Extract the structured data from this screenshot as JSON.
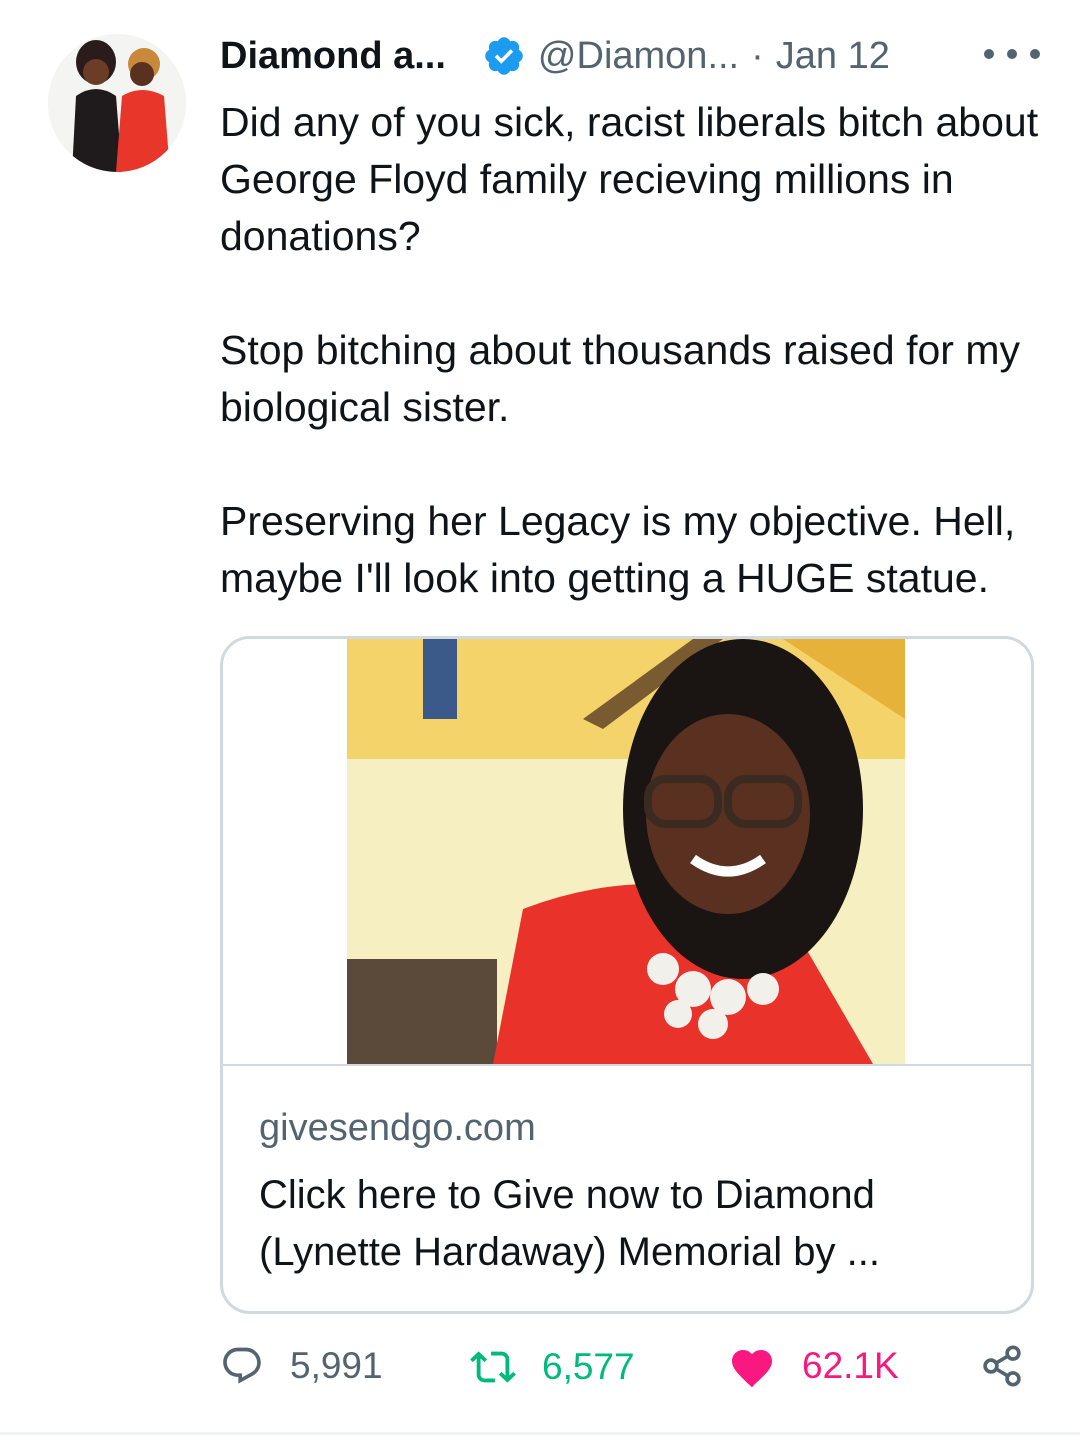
{
  "tweet": {
    "author_name": "Diamond a...",
    "handle": "@Diamon...",
    "separator": "·",
    "date": "Jan 12",
    "paragraphs": [
      "Did any of you sick, racist liberals bitch about George Floyd family recieving millions in donations?",
      "Stop bitching about thousands raised for my biological sister.",
      "Preserving her Legacy is my objective. Hell, maybe I'll look into getting a HUGE statue."
    ]
  },
  "card": {
    "domain": "givesendgo.com",
    "title": "Click here to Give now to Diamond (Lynette Hardaway) Memorial by ..."
  },
  "actions": {
    "replies": "5,991",
    "retweets": "6,577",
    "likes": "62.1K"
  },
  "icons": {
    "verified": "verified-badge-icon",
    "more": "more-options-icon",
    "reply": "reply-icon",
    "retweet": "retweet-icon",
    "like": "heart-icon",
    "share": "share-icon"
  },
  "colors": {
    "verified": "#1d9bf0",
    "retweet_active": "#00ba7c",
    "like_active": "#f91880",
    "secondary_text": "#536471"
  }
}
